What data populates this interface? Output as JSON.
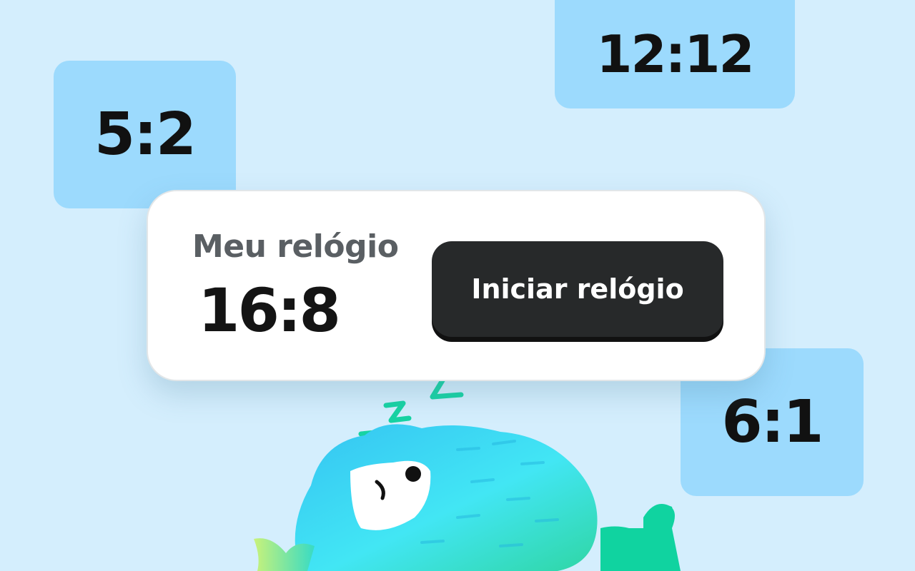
{
  "background_tiles": [
    {
      "text": "5:2"
    },
    {
      "text": "12:12"
    },
    {
      "text": "6:1"
    }
  ],
  "card": {
    "label": "Meu relógio",
    "value": "16:8",
    "button_label": "Iniciar relógio"
  },
  "colors": {
    "background": "#d4eefd",
    "tile": "#9cdafd",
    "button": "#27292a",
    "mascot_primary": "#3fd8f0",
    "sleep_z": "#17d3a3"
  },
  "mascot": {
    "icon": "sleeping-mascot-icon",
    "state": "sleeping"
  }
}
